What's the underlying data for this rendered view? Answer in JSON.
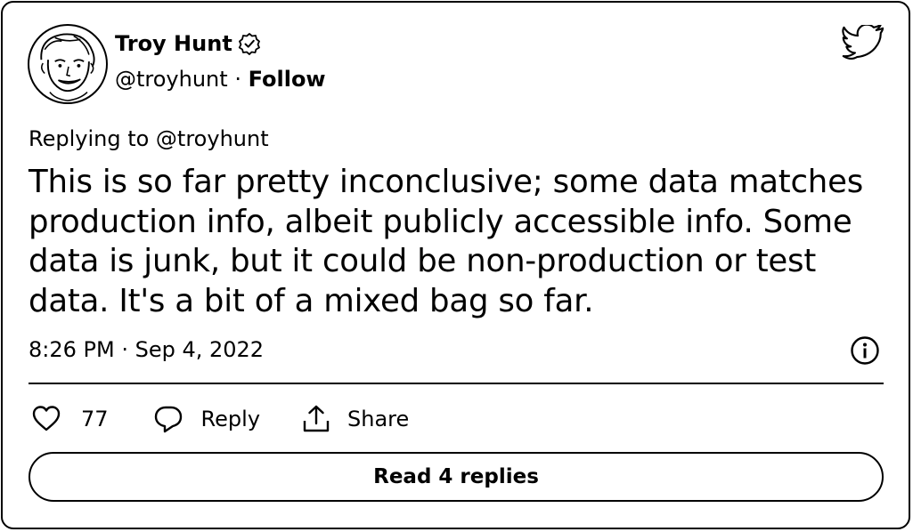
{
  "author": {
    "name": "Troy Hunt",
    "handle": "@troyhunt",
    "separator": " · ",
    "follow_label": "Follow",
    "verified_icon": "verified-badge-icon",
    "avatar_icon": "avatar-portrait"
  },
  "brand_icon": "twitter-bird-icon",
  "tweet": {
    "replying_to": "Replying to @troyhunt",
    "text": "This is so far pretty inconclusive; some data matches production info, albeit publicly accessible info. Some data is junk, but it could be non-production or test data. It's a bit of a mixed bag so far.",
    "timestamp": "8:26 PM · Sep 4, 2022"
  },
  "actions": {
    "like_count": "77",
    "reply_label": "Reply",
    "share_label": "Share"
  },
  "read_replies_label": "Read 4 replies",
  "colors": {
    "foreground": "#000000",
    "background": "#ffffff"
  }
}
